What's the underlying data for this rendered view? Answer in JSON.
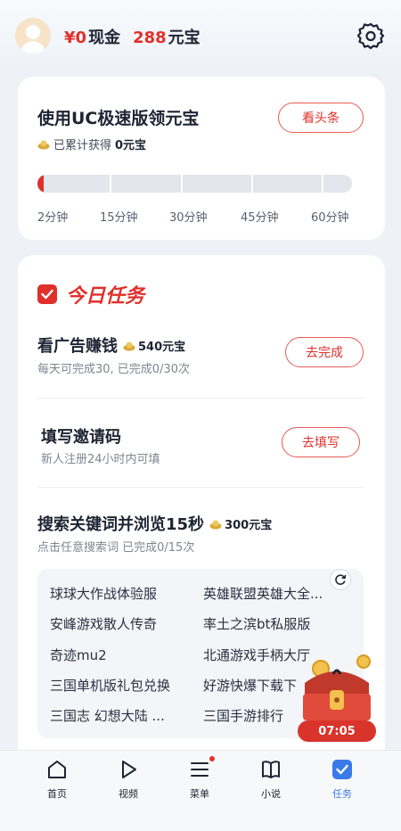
{
  "header": {
    "cash_value": "¥0",
    "cash_label": "现金",
    "ingot_value": "288",
    "ingot_label": "元宝",
    "icons": [
      "avatar",
      "gear-icon"
    ]
  },
  "uc_card": {
    "title": "使用UC极速版领元宝",
    "subtitle_prefix": "已累计获得",
    "subtitle_value": "0元宝",
    "button": "看头条",
    "progress_fraction": 0.02,
    "ticks": [
      "2分钟",
      "15分钟",
      "30分钟",
      "45分钟",
      "60分钟"
    ]
  },
  "tasks": {
    "section_title": "今日任务",
    "items": [
      {
        "title": "看广告赚钱",
        "reward": "540元宝",
        "desc": "每天可完成30, 已完成0/30次",
        "button": "去完成"
      },
      {
        "title": "填写邀请码",
        "desc": "新人注册24小时内可填",
        "button": "去填写"
      },
      {
        "title": "搜索关键词并浏览15秒",
        "reward": "300元宝",
        "desc": "点击任意搜索词 已完成0/15次"
      }
    ],
    "keywords": [
      "球球大作战体验服",
      "英雄联盟英雄大全...",
      "安峰游戏散人传奇",
      "率土之滨bt私服版",
      "奇迹mu2",
      "北通游戏手柄大厅",
      "三国单机版礼包兑换",
      "好游快爆下载下",
      "三国志 幻想大陆 ...",
      "三国手游排行"
    ]
  },
  "floating_chest": {
    "timer": "07:05"
  },
  "tabbar": {
    "items": [
      {
        "label": "首页",
        "icon": "home-icon"
      },
      {
        "label": "视频",
        "icon": "play-icon"
      },
      {
        "label": "菜单",
        "icon": "menu-icon"
      },
      {
        "label": "小说",
        "icon": "book-icon"
      },
      {
        "label": "任务",
        "icon": "task-check-icon",
        "active": true
      }
    ]
  },
  "colors": {
    "accent_red": "#e0302b",
    "active_blue": "#3a7bea",
    "background": "#eef2f7"
  }
}
